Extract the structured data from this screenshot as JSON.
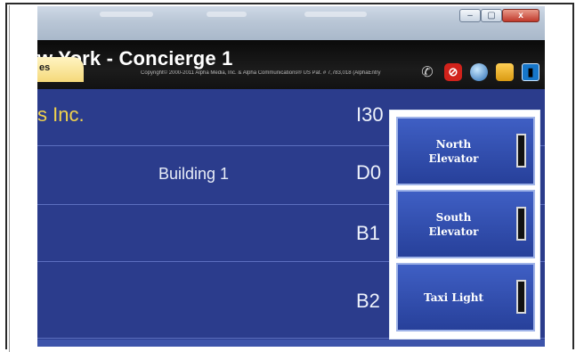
{
  "window": {
    "minimize": "–",
    "maximize": "▢",
    "close": "x"
  },
  "header": {
    "title": "w York - Concierge 1",
    "copyright": "Copyright© 2000-2011 Alpha Media, Inc. & Alpha Communications® US Pat. # 7,783,018 (AlphaEntry",
    "tab_label": "es"
  },
  "toolbar": {
    "icons": [
      "phone-icon",
      "stop-icon",
      "globe-icon",
      "box-icon",
      "door-icon"
    ]
  },
  "rows": [
    {
      "name": "s Inc.",
      "building": "",
      "code": "I30"
    },
    {
      "name": "",
      "building": "Building 1",
      "code": "D0"
    },
    {
      "name": "",
      "building": "",
      "code": "B1"
    },
    {
      "name": "",
      "building": "",
      "code": "B2"
    }
  ],
  "panel": {
    "buttons": [
      {
        "label": "North\nElevator"
      },
      {
        "label": "South\nElevator"
      },
      {
        "label": "Taxi Light"
      }
    ]
  },
  "colors": {
    "list_background": "#2b3c8c",
    "name_text": "#f0d24c",
    "header_background": "#111111",
    "stop_red": "#d1221b"
  }
}
